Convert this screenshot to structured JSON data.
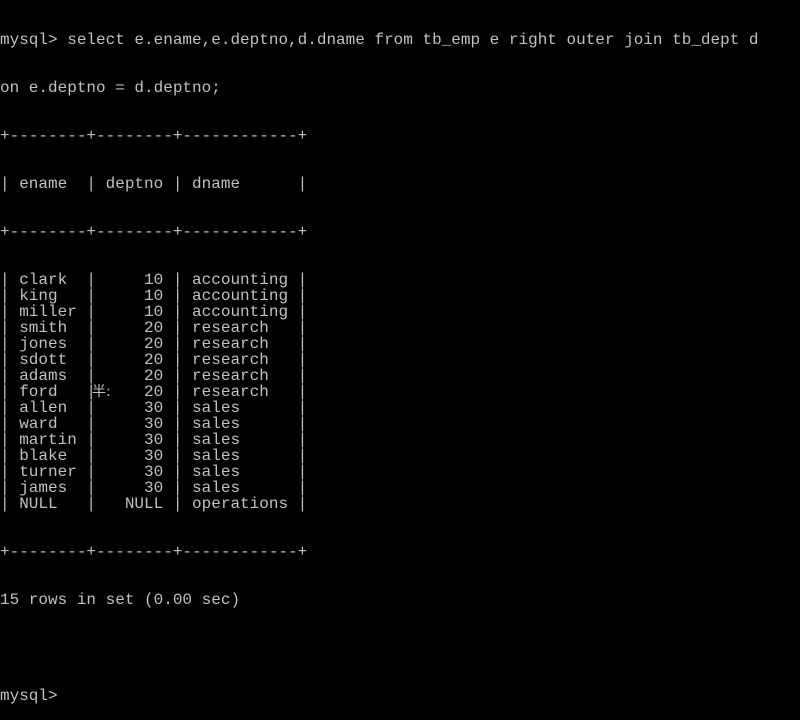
{
  "terminal": {
    "prompt": "mysql>",
    "command_line_1": " select e.ename,e.deptno,d.dname from tb_emp e right outer join tb_dept d",
    "command_line_2": "on e.deptno = d.deptno;",
    "table": {
      "border": "+--------+--------+------------+",
      "columns": [
        "ename",
        "deptno",
        "dname"
      ],
      "header_line": "| ename  | deptno | dname      |",
      "rows": [
        [
          "clark",
          "10",
          "accounting"
        ],
        [
          "king",
          "10",
          "accounting"
        ],
        [
          "miller",
          "10",
          "accounting"
        ],
        [
          "smith",
          "20",
          "research"
        ],
        [
          "jones",
          "20",
          "research"
        ],
        [
          "sdott",
          "20",
          "research"
        ],
        [
          "adams",
          "20",
          "research"
        ],
        [
          "ford",
          "20",
          "research"
        ],
        [
          "allen",
          "30",
          "sales"
        ],
        [
          "ward",
          "30",
          "sales"
        ],
        [
          "martin",
          "30",
          "sales"
        ],
        [
          "blake",
          "30",
          "sales"
        ],
        [
          "turner",
          "30",
          "sales"
        ],
        [
          "james",
          "30",
          "sales"
        ],
        [
          "NULL",
          "NULL",
          "operations"
        ]
      ],
      "row_lines": [
        "| clark  |     10 | accounting |",
        "| king   |     10 | accounting |",
        "| miller |     10 | accounting |",
        "| smith  |     20 | research   |",
        "| jones  |     20 | research   |",
        "| sdott  |     20 | research   |",
        "| adams  |     20 | research   |",
        "| ford   |     20 | research   |",
        "| allen  |     30 | sales      |",
        "| ward   |     30 | sales      |",
        "| martin |     30 | sales      |",
        "| blake  |     30 | sales      |",
        "| turner |     30 | sales      |",
        "| james  |     30 | sales      |",
        "| NULL   |   NULL | operations |"
      ]
    },
    "result_summary": "15 rows in set (0.00 sec)",
    "blank_line": "",
    "next_prompt": "mysql>",
    "ime_hint": "半:"
  },
  "colors": {
    "background": "#000000",
    "text": "#c0c0c0"
  }
}
